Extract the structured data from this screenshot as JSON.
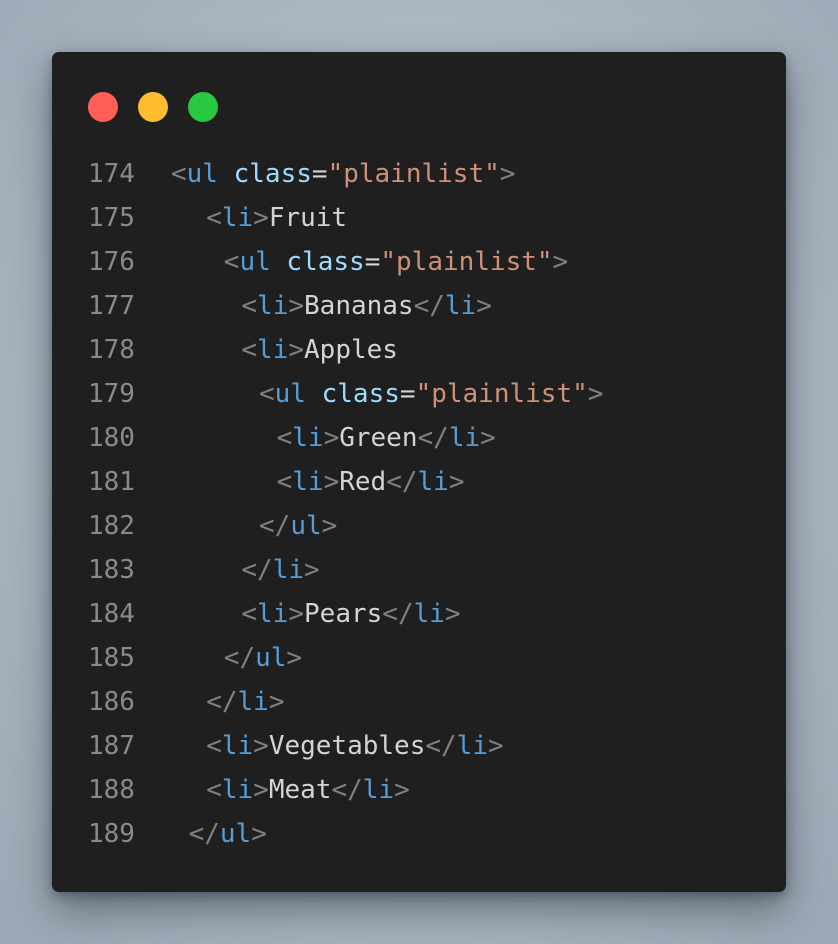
{
  "colors": {
    "window_bg": "#1f1f1f",
    "line_number": "#8a8a8a",
    "punct": "#808080",
    "tag": "#569cd6",
    "attr": "#9cdcfe",
    "equals": "#d4d4d4",
    "string": "#ce9178",
    "text": "#d4d4d4",
    "dot_red": "#ff5f57",
    "dot_yellow": "#febc2e",
    "dot_green": "#28c840"
  },
  "window_controls": [
    {
      "name": "close-icon",
      "color_key": "dot_red"
    },
    {
      "name": "minimize-icon",
      "color_key": "dot_yellow"
    },
    {
      "name": "maximize-icon",
      "color_key": "dot_green"
    }
  ],
  "lines": [
    {
      "num": "174",
      "indent": 0,
      "tokens": [
        [
          "punct",
          "<"
        ],
        [
          "tag",
          "ul"
        ],
        [
          "text",
          " "
        ],
        [
          "attr",
          "class"
        ],
        [
          "equals",
          "="
        ],
        [
          "string",
          "\"plainlist\""
        ],
        [
          "punct",
          ">"
        ]
      ]
    },
    {
      "num": "175",
      "indent": 2,
      "tokens": [
        [
          "punct",
          "<"
        ],
        [
          "tag",
          "li"
        ],
        [
          "punct",
          ">"
        ],
        [
          "text",
          "Fruit"
        ]
      ]
    },
    {
      "num": "176",
      "indent": 3,
      "tokens": [
        [
          "punct",
          "<"
        ],
        [
          "tag",
          "ul"
        ],
        [
          "text",
          " "
        ],
        [
          "attr",
          "class"
        ],
        [
          "equals",
          "="
        ],
        [
          "string",
          "\"plainlist\""
        ],
        [
          "punct",
          ">"
        ]
      ]
    },
    {
      "num": "177",
      "indent": 4,
      "tokens": [
        [
          "punct",
          "<"
        ],
        [
          "tag",
          "li"
        ],
        [
          "punct",
          ">"
        ],
        [
          "text",
          "Bananas"
        ],
        [
          "punct",
          "</"
        ],
        [
          "tag",
          "li"
        ],
        [
          "punct",
          ">"
        ]
      ]
    },
    {
      "num": "178",
      "indent": 4,
      "tokens": [
        [
          "punct",
          "<"
        ],
        [
          "tag",
          "li"
        ],
        [
          "punct",
          ">"
        ],
        [
          "text",
          "Apples"
        ]
      ]
    },
    {
      "num": "179",
      "indent": 5,
      "tokens": [
        [
          "punct",
          "<"
        ],
        [
          "tag",
          "ul"
        ],
        [
          "text",
          " "
        ],
        [
          "attr",
          "class"
        ],
        [
          "equals",
          "="
        ],
        [
          "string",
          "\"plainlist\""
        ],
        [
          "punct",
          ">"
        ]
      ]
    },
    {
      "num": "180",
      "indent": 6,
      "tokens": [
        [
          "punct",
          "<"
        ],
        [
          "tag",
          "li"
        ],
        [
          "punct",
          ">"
        ],
        [
          "text",
          "Green"
        ],
        [
          "punct",
          "</"
        ],
        [
          "tag",
          "li"
        ],
        [
          "punct",
          ">"
        ]
      ]
    },
    {
      "num": "181",
      "indent": 6,
      "tokens": [
        [
          "punct",
          "<"
        ],
        [
          "tag",
          "li"
        ],
        [
          "punct",
          ">"
        ],
        [
          "text",
          "Red"
        ],
        [
          "punct",
          "</"
        ],
        [
          "tag",
          "li"
        ],
        [
          "punct",
          ">"
        ]
      ]
    },
    {
      "num": "182",
      "indent": 5,
      "tokens": [
        [
          "punct",
          "</"
        ],
        [
          "tag",
          "ul"
        ],
        [
          "punct",
          ">"
        ]
      ]
    },
    {
      "num": "183",
      "indent": 4,
      "tokens": [
        [
          "punct",
          "</"
        ],
        [
          "tag",
          "li"
        ],
        [
          "punct",
          ">"
        ]
      ]
    },
    {
      "num": "184",
      "indent": 4,
      "tokens": [
        [
          "punct",
          "<"
        ],
        [
          "tag",
          "li"
        ],
        [
          "punct",
          ">"
        ],
        [
          "text",
          "Pears"
        ],
        [
          "punct",
          "</"
        ],
        [
          "tag",
          "li"
        ],
        [
          "punct",
          ">"
        ]
      ]
    },
    {
      "num": "185",
      "indent": 3,
      "tokens": [
        [
          "punct",
          "</"
        ],
        [
          "tag",
          "ul"
        ],
        [
          "punct",
          ">"
        ]
      ]
    },
    {
      "num": "186",
      "indent": 2,
      "tokens": [
        [
          "punct",
          "</"
        ],
        [
          "tag",
          "li"
        ],
        [
          "punct",
          ">"
        ]
      ]
    },
    {
      "num": "187",
      "indent": 2,
      "tokens": [
        [
          "punct",
          "<"
        ],
        [
          "tag",
          "li"
        ],
        [
          "punct",
          ">"
        ],
        [
          "text",
          "Vegetables"
        ],
        [
          "punct",
          "</"
        ],
        [
          "tag",
          "li"
        ],
        [
          "punct",
          ">"
        ]
      ]
    },
    {
      "num": "188",
      "indent": 2,
      "tokens": [
        [
          "punct",
          "<"
        ],
        [
          "tag",
          "li"
        ],
        [
          "punct",
          ">"
        ],
        [
          "text",
          "Meat"
        ],
        [
          "punct",
          "</"
        ],
        [
          "tag",
          "li"
        ],
        [
          "punct",
          ">"
        ]
      ]
    },
    {
      "num": "189",
      "indent": 1,
      "tokens": [
        [
          "punct",
          "</"
        ],
        [
          "tag",
          "ul"
        ],
        [
          "punct",
          ">"
        ]
      ]
    }
  ]
}
